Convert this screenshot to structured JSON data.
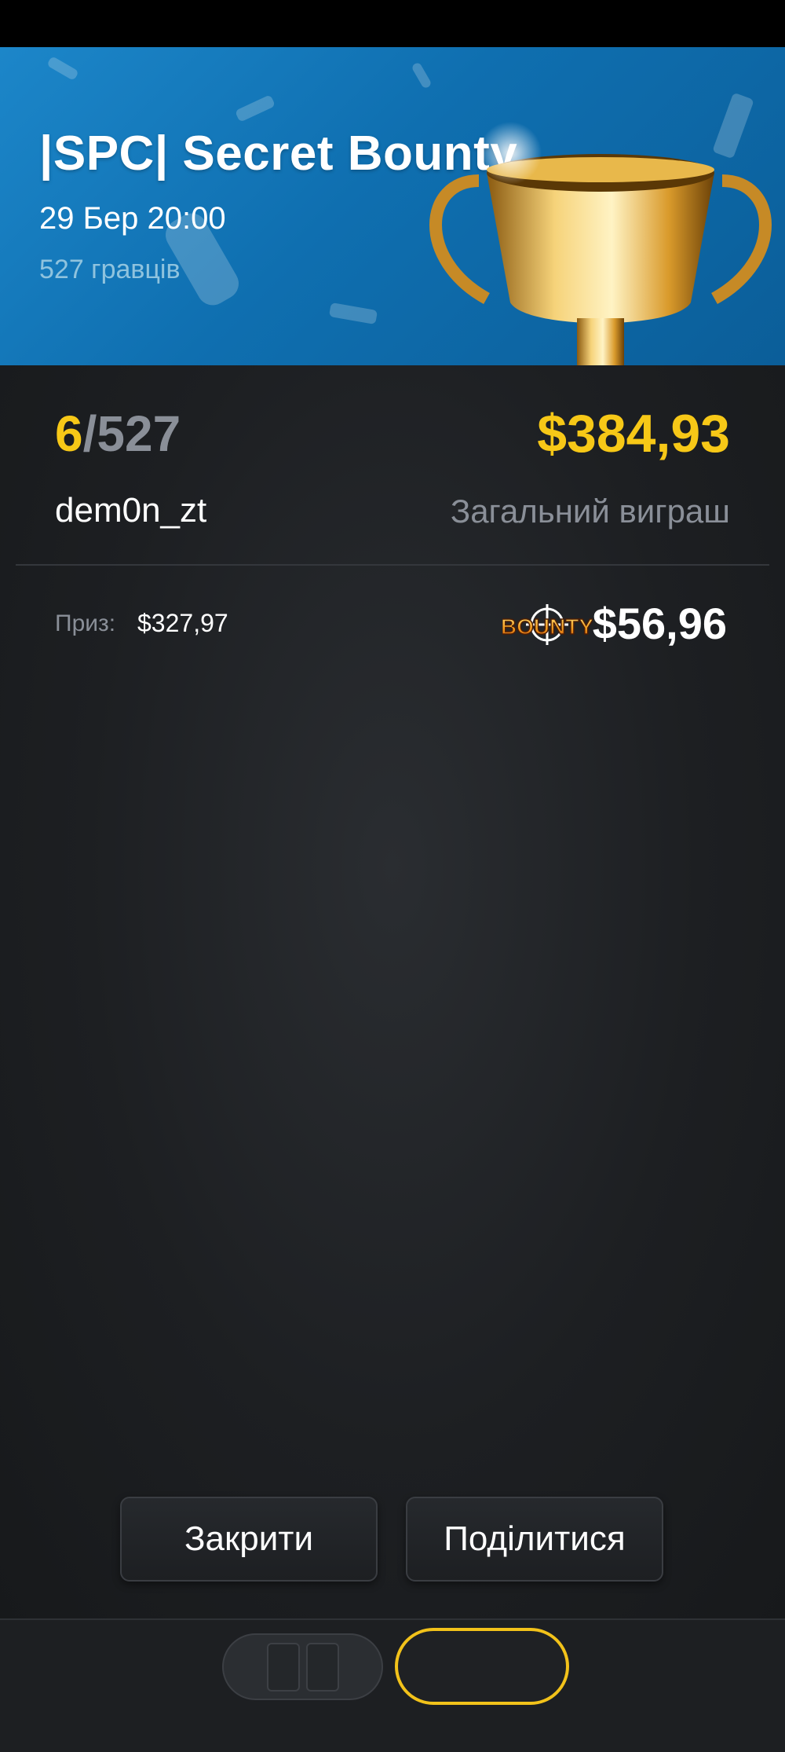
{
  "banner": {
    "title": "|SPC| Secret Bounty",
    "date": "29 Бер 20:00",
    "players": "527 гравців"
  },
  "result": {
    "position": "6",
    "separator": "/",
    "total_players": "527",
    "username": "dem0n_zt",
    "total_win": "$384,93",
    "total_win_label": "Загальний виграш",
    "prize_label": "Приз:",
    "prize_value": "$327,97",
    "bounty_logo_text": "BOUNTY",
    "bounty_value": "$56,96"
  },
  "buttons": {
    "close": "Закрити",
    "share": "Поділитися"
  },
  "colors": {
    "accent": "#f7c817",
    "muted": "#8a8f98",
    "panel": "#1d1f22",
    "banner": "#1580c2",
    "tab_active_border": "#f2c21a"
  },
  "icons": {
    "trophy": "trophy-icon",
    "bounty": "bounty-logo",
    "tab_left": "multi-table-icon",
    "tab_right": "active-table-tab"
  }
}
